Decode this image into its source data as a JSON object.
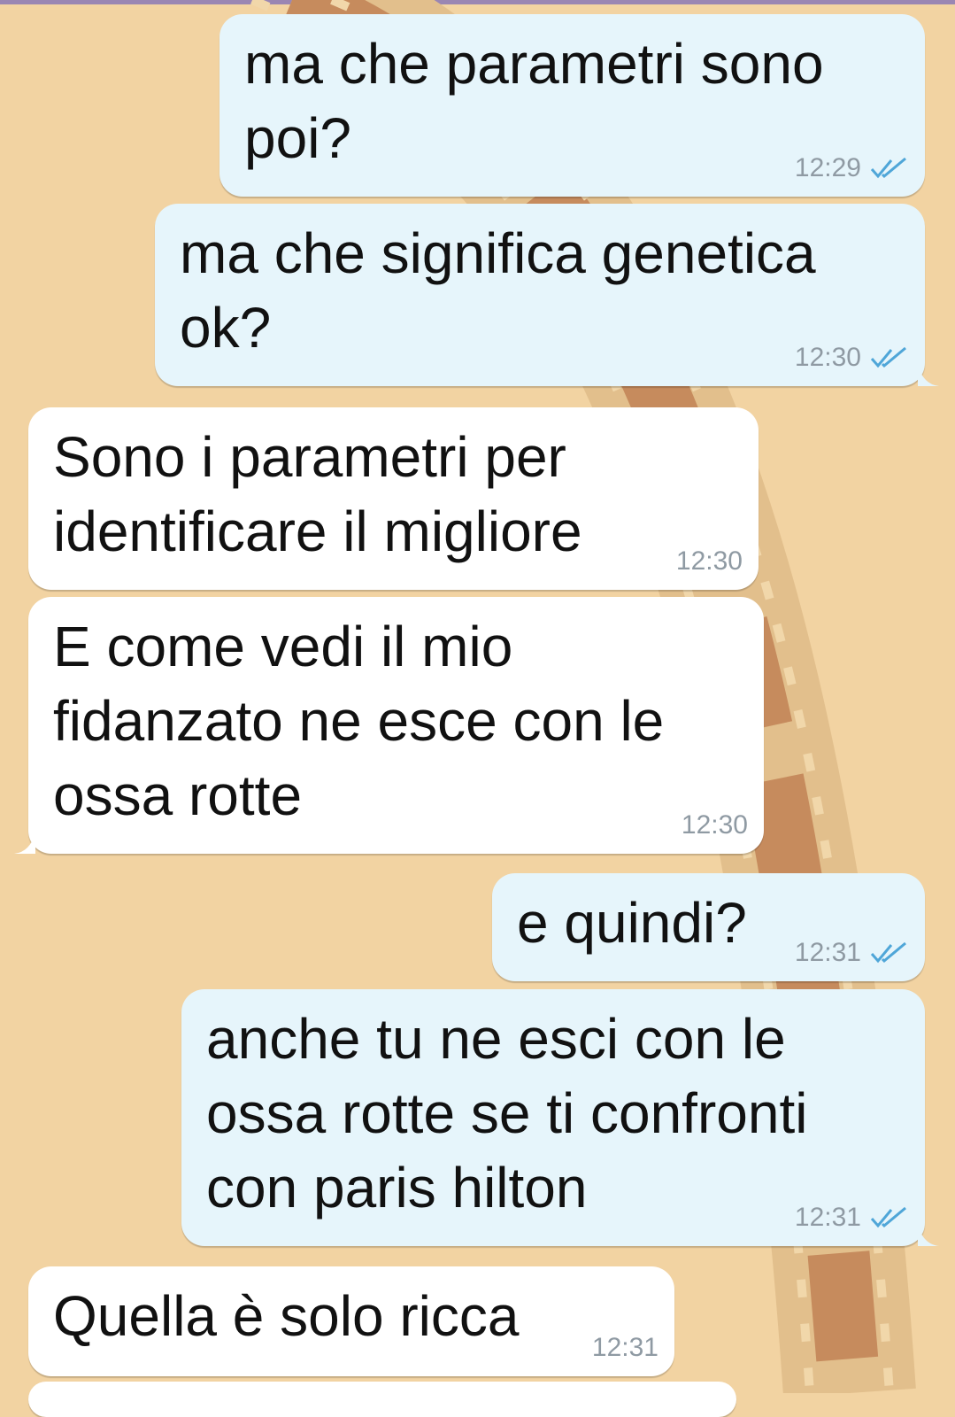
{
  "messages": [
    {
      "direction": "outgoing",
      "text": "ma che parametri sono\npoi?",
      "time": "12:29",
      "status_icon": "double-check-icon",
      "status_color": "#4fa6d8"
    },
    {
      "direction": "outgoing",
      "text": "ma che significa genetica\nok?",
      "time": "12:30",
      "status_icon": "double-check-icon",
      "status_color": "#4fa6d8"
    },
    {
      "direction": "incoming",
      "text": "Sono i parametri per\nidentificare il migliore",
      "time": "12:30"
    },
    {
      "direction": "incoming",
      "text": "E come vedi il mio\nfidanzato ne esce con le\nossa rotte",
      "time": "12:30"
    },
    {
      "direction": "outgoing",
      "text": "e quindi?",
      "time": "12:31",
      "status_icon": "double-check-icon",
      "status_color": "#4fa6d8"
    },
    {
      "direction": "outgoing",
      "text": "anche tu ne esci con le\nossa rotte se ti confronti\ncon paris hilton",
      "time": "12:31",
      "status_icon": "double-check-icon",
      "status_color": "#4fa6d8"
    },
    {
      "direction": "incoming",
      "text": "Quella è solo ricca",
      "time": "12:31"
    }
  ],
  "colors": {
    "wallpaper": "#f2d3a2",
    "outgoing_bubble": "#e6f5fb",
    "incoming_bubble": "#ffffff",
    "timestamp": "#8f9aa3",
    "read_ticks": "#4fa6d8",
    "top_bar": "#9a86b3"
  }
}
